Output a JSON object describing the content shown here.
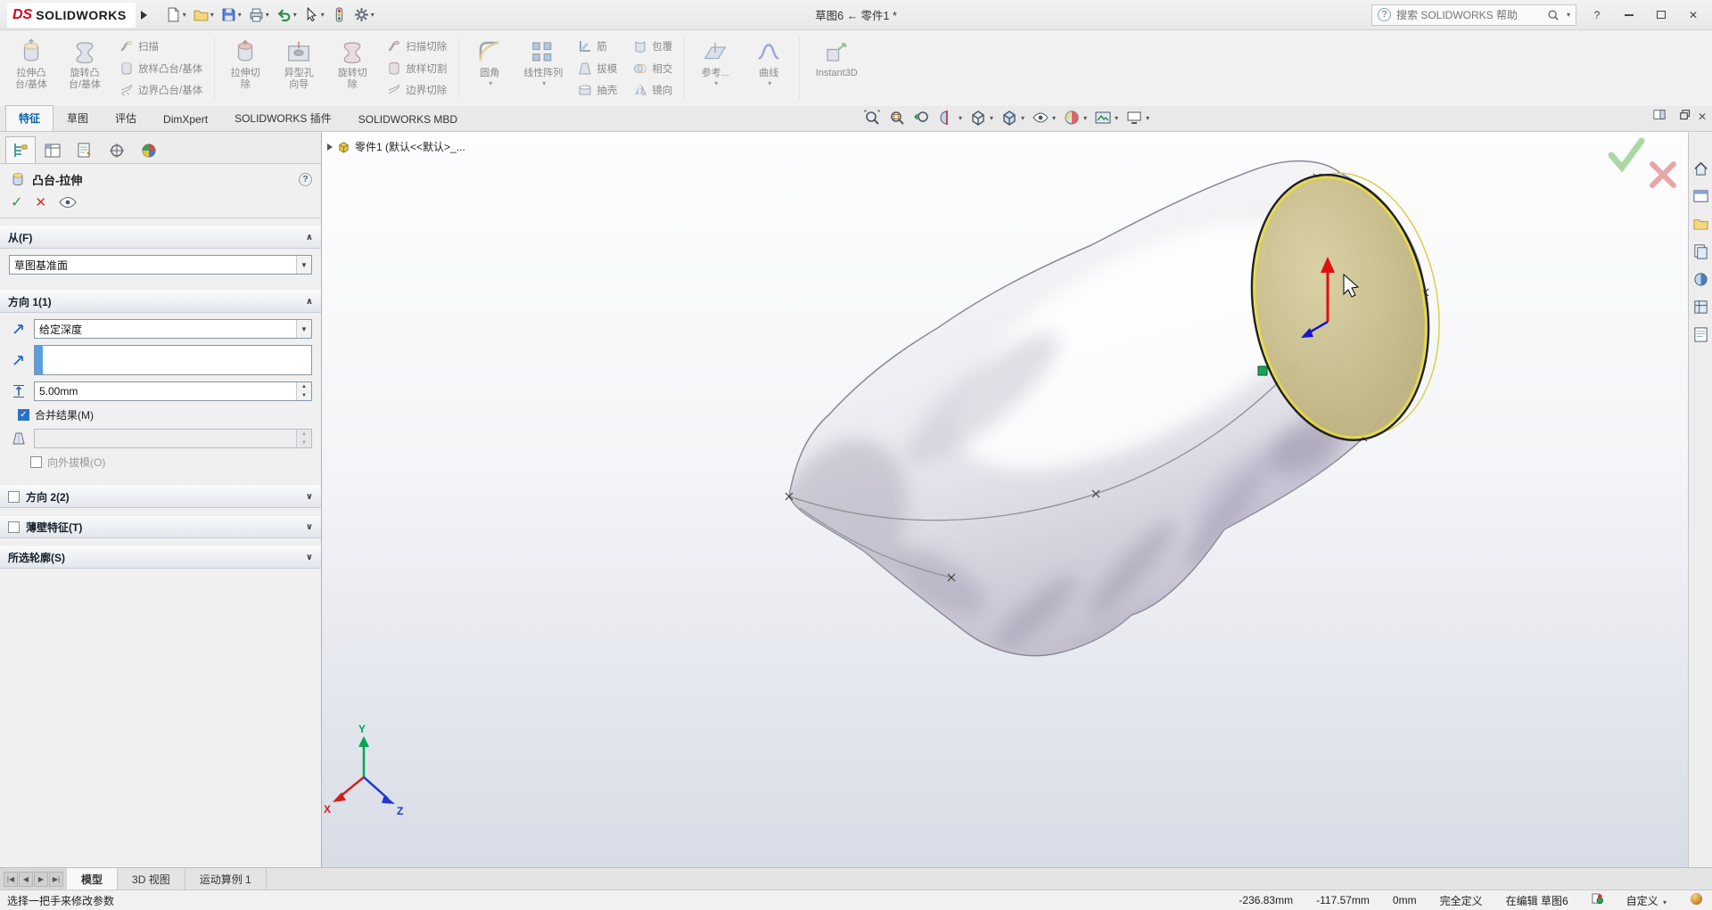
{
  "titlebar": {
    "brand_ds": "DS",
    "brand": "SOLIDWORKS",
    "document_title": "草图6 ← 零件1 *",
    "search_placeholder": "搜索 SOLIDWORKS 帮助",
    "help": "?"
  },
  "command_tabs": {
    "features": "特征",
    "sketch": "草图",
    "evaluate": "评估",
    "dimxpert": "DimXpert",
    "addins": "SOLIDWORKS 插件",
    "mbd": "SOLIDWORKS MBD"
  },
  "ribbon": {
    "extrude_boss": {
      "l1": "拉伸凸",
      "l2": "台/基体"
    },
    "revolve_boss": {
      "l1": "旋转凸",
      "l2": "台/基体"
    },
    "sweep": "扫描",
    "loft": "放样凸台/基体",
    "boundary": "边界凸台/基体",
    "extrude_cut": {
      "l1": "拉伸切",
      "l2": "除"
    },
    "hole_wizard": {
      "l1": "异型孔",
      "l2": "向导"
    },
    "revolve_cut": {
      "l1": "旋转切",
      "l2": "除"
    },
    "sweep_cut": "扫描切除",
    "loft_cut": "放样切割",
    "boundary_cut": "边界切除",
    "fillet": "圆角",
    "linear_pattern": "线性阵列",
    "rib": "筋",
    "draft": "拔模",
    "shell": "抽壳",
    "wrap": "包覆",
    "intersect": "相交",
    "mirror": "镜向",
    "reference": "参考...",
    "curves": "曲线",
    "instant3d": "Instant3D"
  },
  "property_manager": {
    "title": "凸台-拉伸",
    "from_header": "从(F)",
    "from_value": "草图基准面",
    "dir1_header": "方向 1(1)",
    "dir1_end_condition": "给定深度",
    "dir1_depth": "5.00mm",
    "dir1_merge": "合并结果(M)",
    "dir1_draft_out": "向外拔模(O)",
    "dir2_header": "方向 2(2)",
    "thin_header": "薄壁特征(T)",
    "contours_header": "所选轮廓(S)"
  },
  "viewport": {
    "breadcrumb": "零件1 (默认<<默认>_...",
    "axis_x": "X",
    "axis_y": "Y",
    "axis_z": "Z"
  },
  "bottom_tabs": {
    "model": "模型",
    "views": "3D 视图",
    "motion": "运动算例 1"
  },
  "statusbar": {
    "message": "选择一把手来修改参数",
    "x": "-236.83mm",
    "y": "-117.57mm",
    "z": "0mm",
    "state": "完全定义",
    "editing": "在编辑 草图6",
    "custom": "自定义"
  },
  "colors": {
    "face_tan": "#c9bd8a",
    "preview_yellow": "#e6da35",
    "selection_blue": "#5a9fe0",
    "brand_red": "#d6001c"
  }
}
